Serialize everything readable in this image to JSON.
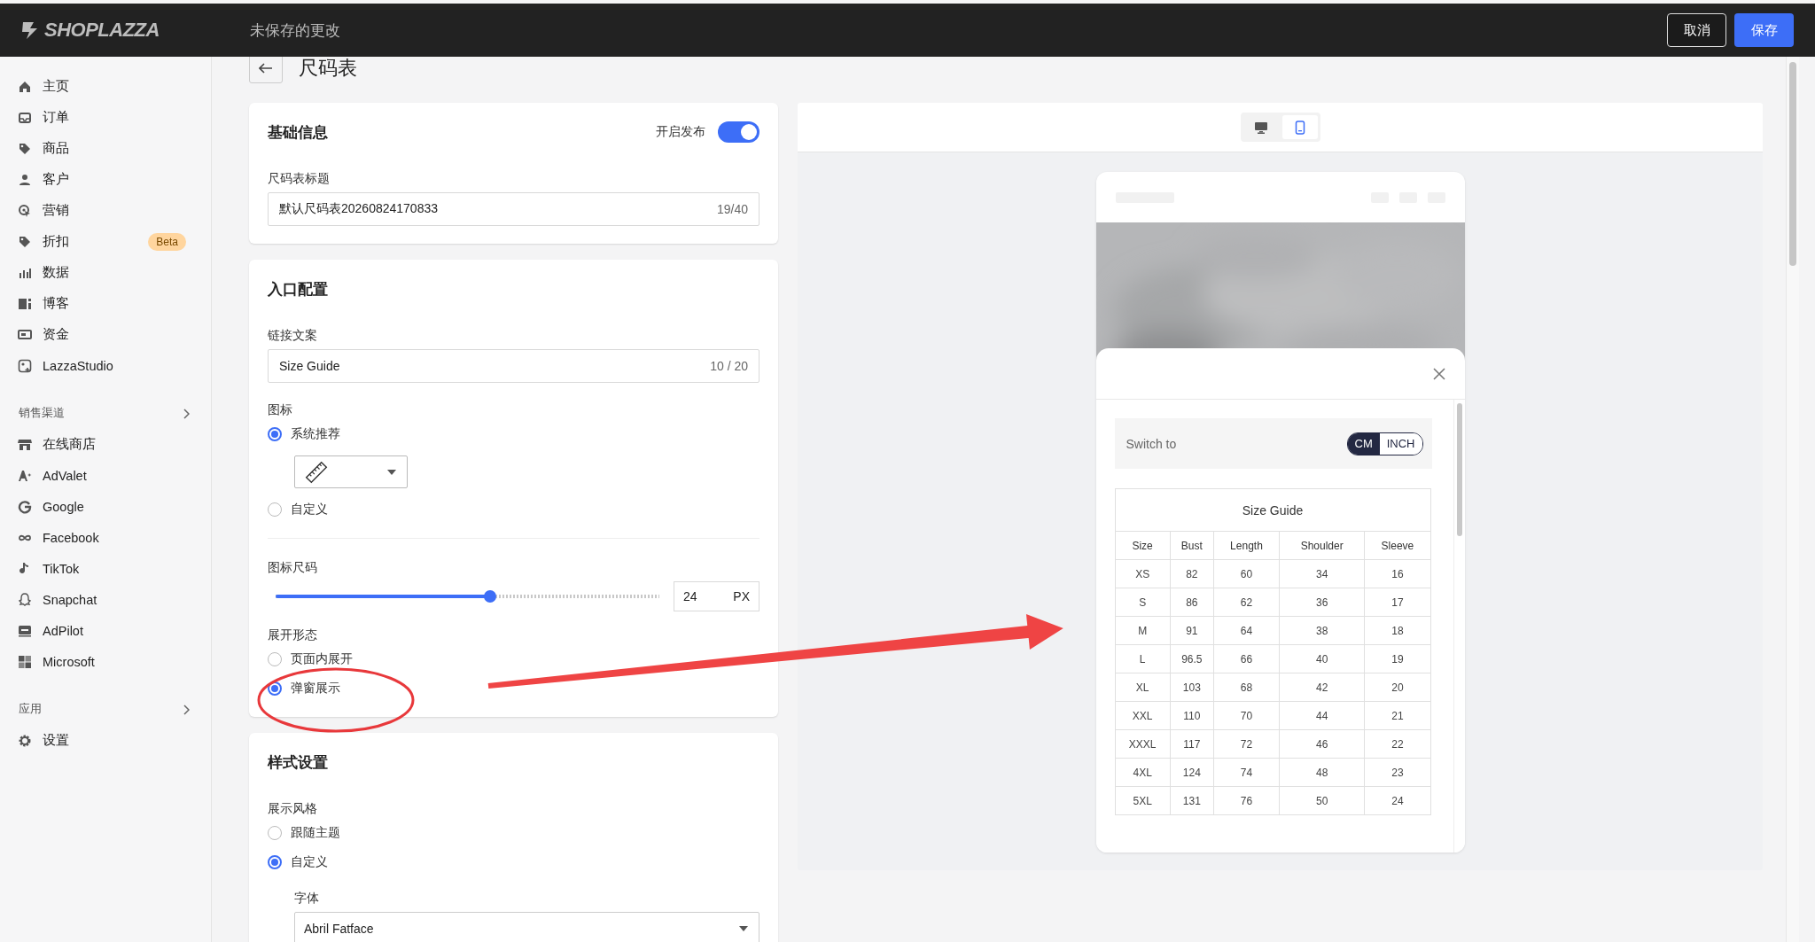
{
  "topbar": {
    "logo": "SHOPLAZZA",
    "status": "未保存的更改",
    "buttons": [
      {
        "label": "取消",
        "kind": "secondary"
      },
      {
        "label": "保存",
        "kind": "primary"
      }
    ]
  },
  "sidebar": {
    "groups": [
      {
        "items": [
          {
            "label": "主页"
          },
          {
            "label": "订单"
          },
          {
            "label": "商品"
          },
          {
            "label": "客户"
          },
          {
            "label": "营销"
          },
          {
            "label": "折扣",
            "badge": "Beta"
          },
          {
            "label": "数据"
          },
          {
            "label": "博客"
          },
          {
            "label": "资金"
          },
          {
            "label": "LazzaStudio"
          }
        ]
      },
      {
        "heading": "销售渠道",
        "items": [
          {
            "label": "在线商店"
          },
          {
            "label": "AdValet"
          },
          {
            "label": "Google"
          },
          {
            "label": "Facebook"
          },
          {
            "label": "TikTok"
          },
          {
            "label": "Snapchat"
          },
          {
            "label": "AdPilot"
          },
          {
            "label": "Microsoft"
          }
        ]
      },
      {
        "heading": "应用"
      },
      {
        "items": [
          {
            "label": "设置"
          }
        ]
      }
    ]
  },
  "page": {
    "title": "尺码表"
  },
  "cards": [
    {
      "title": "基础信息",
      "toggle": {
        "label": "开启发布",
        "on": true
      },
      "fields": [
        {
          "kind": "label",
          "text": "尺码表标题"
        },
        {
          "kind": "input",
          "value": "默认尺码表20260824170833",
          "counter": "19/40"
        }
      ]
    },
    {
      "title": "入口配置",
      "fields": [
        {
          "kind": "label",
          "text": "链接文案"
        },
        {
          "kind": "input",
          "value": "Size Guide",
          "counter": "10 / 20"
        },
        {
          "kind": "label",
          "text": "图标"
        },
        {
          "kind": "radio",
          "label": "系统推荐",
          "selected": true
        },
        {
          "kind": "icon_select"
        },
        {
          "kind": "radio",
          "label": "自定义",
          "selected": false
        },
        {
          "kind": "divider"
        },
        {
          "kind": "label",
          "text": "图标尺码"
        },
        {
          "kind": "slider",
          "level": 0.56,
          "value": "24",
          "unit": "PX"
        },
        {
          "kind": "label",
          "text": "展开形态"
        },
        {
          "kind": "radio",
          "label": "页面内展开",
          "selected": false
        },
        {
          "kind": "radio",
          "label": "弹窗展示",
          "selected": true
        }
      ]
    },
    {
      "title": "样式设置",
      "fields": [
        {
          "kind": "label",
          "text": "展示风格"
        },
        {
          "kind": "radio",
          "label": "跟随主题",
          "selected": false
        },
        {
          "kind": "radio",
          "label": "自定义",
          "selected": true
        },
        {
          "kind": "sublabel",
          "text": "字体"
        },
        {
          "kind": "select",
          "value": "Abril Fatface"
        }
      ]
    }
  ],
  "preview": {
    "devices": [
      {
        "kind": "desktop",
        "selected": false
      },
      {
        "kind": "mobile",
        "selected": true
      }
    ],
    "switch_label": "Switch to",
    "units": [
      {
        "label": "CM",
        "selected": true
      },
      {
        "label": "INCH",
        "selected": false
      }
    ],
    "table": {
      "title": "Size Guide",
      "columns": [
        "Size",
        "Bust",
        "Length",
        "Shoulder",
        "Sleeve"
      ],
      "rows": [
        [
          "XS",
          "82",
          "60",
          "34",
          "16"
        ],
        [
          "S",
          "86",
          "62",
          "36",
          "17"
        ],
        [
          "M",
          "91",
          "64",
          "38",
          "18"
        ],
        [
          "L",
          "96.5",
          "66",
          "40",
          "19"
        ],
        [
          "XL",
          "103",
          "68",
          "42",
          "20"
        ],
        [
          "XXL",
          "110",
          "70",
          "44",
          "21"
        ],
        [
          "XXXL",
          "117",
          "72",
          "46",
          "22"
        ],
        [
          "4XL",
          "124",
          "74",
          "48",
          "23"
        ],
        [
          "5XL",
          "131",
          "76",
          "50",
          "24"
        ]
      ]
    }
  },
  "annotations": [
    {
      "kind": "ellipse"
    },
    {
      "kind": "arrow"
    }
  ]
}
